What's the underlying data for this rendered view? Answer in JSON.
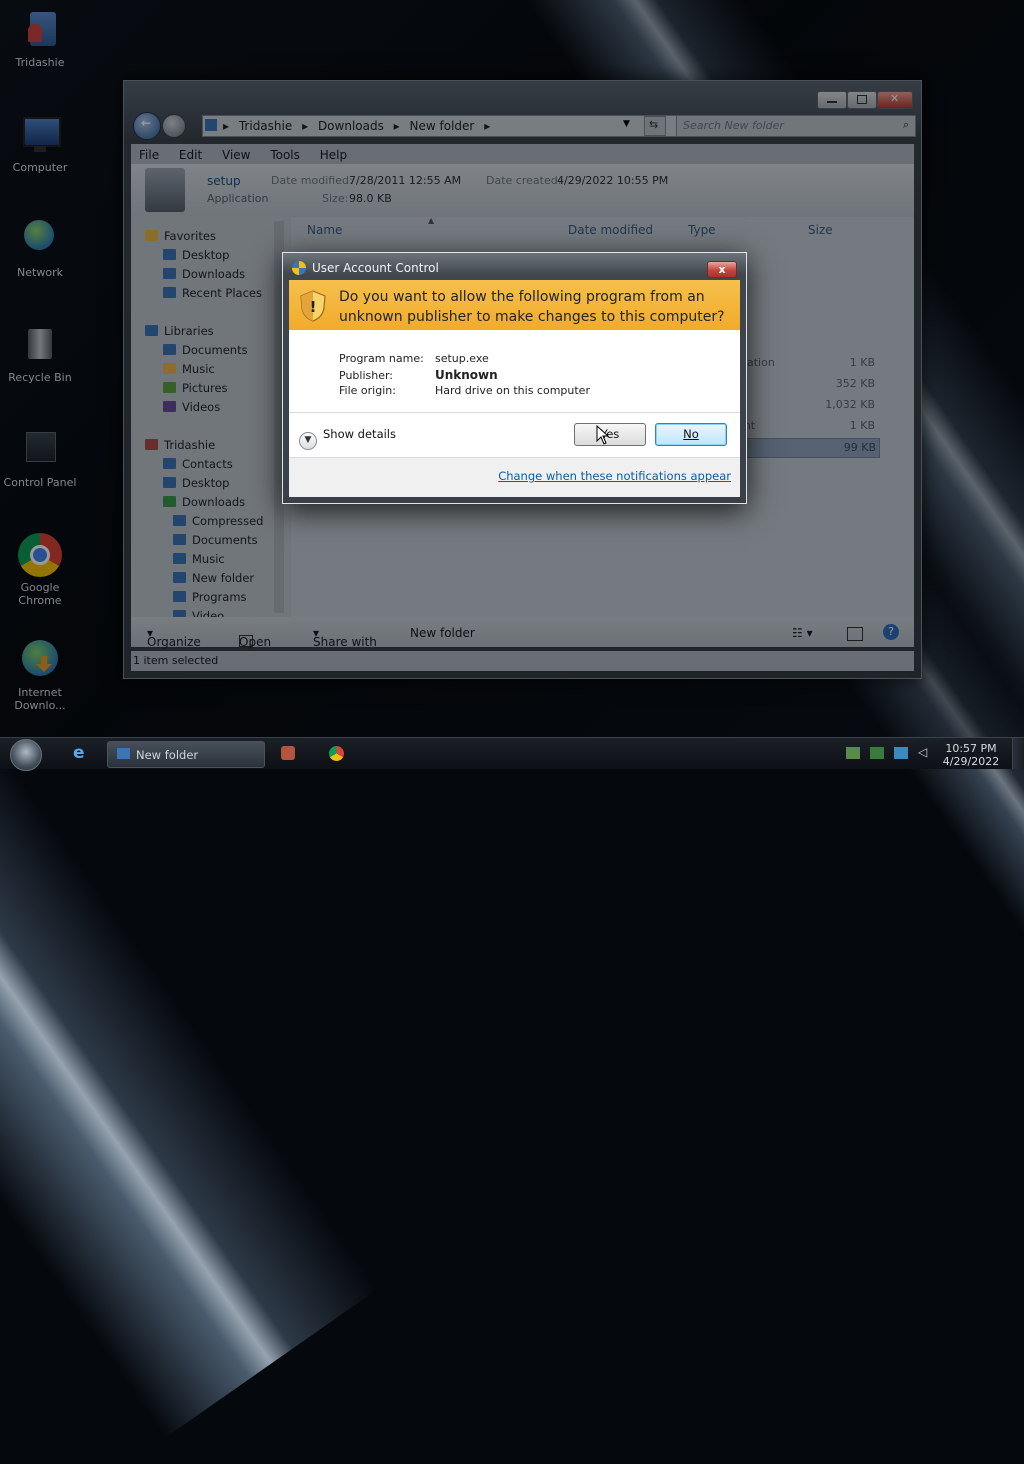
{
  "desktop": {
    "icons": [
      {
        "label": "Tridashie"
      },
      {
        "label": "Computer"
      },
      {
        "label": "Network"
      },
      {
        "label": "Recycle Bin"
      },
      {
        "label": "Control Panel"
      },
      {
        "label": "Google Chrome"
      },
      {
        "label": "Internet Downlo..."
      }
    ]
  },
  "explorer": {
    "address": {
      "crumbs": [
        "Tridashie",
        "Downloads",
        "New folder"
      ]
    },
    "search_placeholder": "Search New folder",
    "menu": [
      "File",
      "Edit",
      "View",
      "Tools",
      "Help"
    ],
    "details": {
      "filename": "setup",
      "filetype": "Application",
      "date_modified_label": "Date modified:",
      "date_modified": "7/28/2011 12:55 AM",
      "date_created_label": "Date created:",
      "date_created": "4/29/2022 10:55 PM",
      "size_label": "Size:",
      "size": "98.0 KB"
    },
    "nav": {
      "favorites_header": "Favorites",
      "favorites": [
        "Desktop",
        "Downloads",
        "Recent Places"
      ],
      "libraries_header": "Libraries",
      "libraries": [
        "Documents",
        "Music",
        "Pictures",
        "Videos"
      ],
      "user_header": "Tridashie",
      "user_items": [
        "Contacts",
        "Desktop",
        "Downloads"
      ],
      "downloads_children": [
        "Compressed",
        "Documents",
        "Music",
        "New folder",
        "Programs",
        "Video"
      ]
    },
    "columns": [
      "Name",
      "Date modified",
      "Type",
      "Size"
    ],
    "rows": [
      {
        "type_partial": "ation",
        "size": "1 KB"
      },
      {
        "type_partial": "",
        "size": "352 KB"
      },
      {
        "type_partial": "",
        "size": "1,032 KB"
      },
      {
        "type_partial": "ent",
        "size": "1 KB"
      },
      {
        "type_partial": "",
        "size": "99 KB"
      }
    ],
    "toolbar": {
      "organize": "Organize",
      "open": "Open",
      "share_with": "Share with",
      "new_folder": "New folder"
    },
    "status": "1 item selected"
  },
  "uac": {
    "title": "User Account Control",
    "close": "x",
    "question_line1": "Do you want to allow the following program from an",
    "question_line2": "unknown publisher to make changes to this computer?",
    "program_name_label": "Program name:",
    "program_name": "setup.exe",
    "publisher_label": "Publisher:",
    "publisher": "Unknown",
    "file_origin_label": "File origin:",
    "file_origin": "Hard drive on this computer",
    "show_details": "Show details",
    "yes": "Yes",
    "no": "No",
    "link": "Change when these notifications appear"
  },
  "taskbar": {
    "task_label": "New folder",
    "time": "10:57 PM",
    "date": "4/29/2022"
  },
  "colors": {
    "uac_banner": "#f1ab2c",
    "link": "#0b5ea6",
    "window_frame": "#3a434d"
  }
}
